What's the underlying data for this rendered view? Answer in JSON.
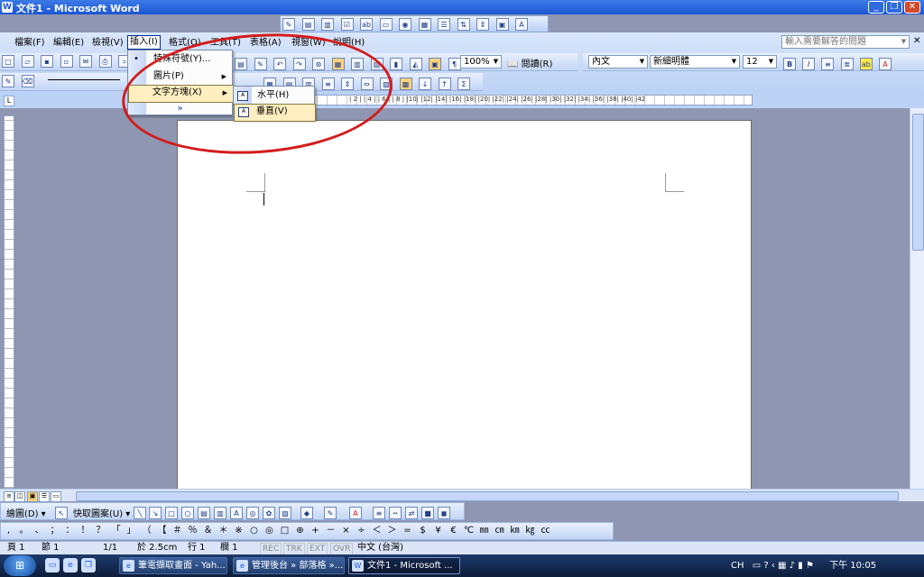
{
  "window": {
    "title": "文件1 - Microsoft Word",
    "icon": "word-icon"
  },
  "menubar": {
    "items": [
      "檔案(F)",
      "編輯(E)",
      "檢視(V)",
      "插入(I)",
      "格式(O)",
      "工具(T)",
      "表格(A)",
      "視窗(W)",
      "說明(H)"
    ],
    "ask_placeholder": "輸入需要解答的問題"
  },
  "toolbar": {
    "zoom": "100%",
    "reading": "閱讀(R)",
    "style": "內文",
    "font": "新細明體",
    "size": "12"
  },
  "ruler_labels": "| 2 |  | 4 |  | 6 |  | 8 |  |10|  |12|  |14|  |16|  |18|  |20|  |22|  |24|  |26|  |28|  |30|  |32|  |34|  |36|  |38|  |40|  |42",
  "insert_menu": {
    "items": [
      {
        "label": "特殊符號(Y)...",
        "icon": "omega-symbol-icon"
      },
      {
        "label": "圖片(P)",
        "submenu": true
      },
      {
        "label": "文字方塊(X)",
        "submenu": true,
        "highlighted": true
      },
      {
        "label": "»",
        "expand": true
      }
    ]
  },
  "textbox_submenu": {
    "items": [
      {
        "label": "水平(H)",
        "icon": "horizontal-textbox-icon"
      },
      {
        "label": "垂直(V)",
        "icon": "vertical-textbox-icon",
        "highlighted": true
      }
    ]
  },
  "drawing_toolbar": {
    "draw": "繪圖(D) ▾",
    "autoshapes": "快取圖案(U) ▾"
  },
  "symbol_toolbar": [
    ",",
    "。",
    "、",
    "；",
    "：",
    "！",
    "？",
    "「",
    "」",
    "（",
    "【",
    "＃",
    "％",
    "＆",
    "＊",
    "※",
    "○",
    "◎",
    "□",
    "⊕",
    "+",
    "－",
    "×",
    "÷",
    "＜",
    "＞",
    "=",
    "$",
    "¥",
    "€",
    "℃",
    "㎜",
    "㎝",
    "㎞",
    "㎏",
    "㏄"
  ],
  "statusbar": {
    "page": "頁 1",
    "section": "節 1",
    "pages": "1/1",
    "at": "於 2.5cm",
    "line": "行 1",
    "col": "欄 1",
    "rec": "REC",
    "trk": "TRK",
    "ext": "EXT",
    "ovr": "OVR",
    "lang": "中文 (台灣)"
  },
  "taskbar": {
    "tasks": [
      {
        "label": "筆電擷取畫面 - Yah...",
        "icon": "ie-icon",
        "active": false
      },
      {
        "label": "管理後台 » 部落格 »...",
        "icon": "ie-icon",
        "active": false
      },
      {
        "label": "文件1 - Microsoft ...",
        "icon": "word-icon",
        "active": true
      }
    ],
    "lang": "CH",
    "time": "下午 10:05"
  },
  "colors": {
    "annotation": "#d31c1c",
    "highlight": "#ffeebf",
    "titlebar": "#1c56d4"
  }
}
